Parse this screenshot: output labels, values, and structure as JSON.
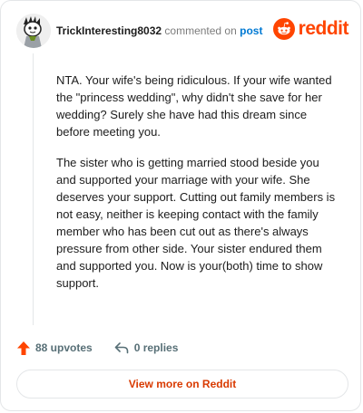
{
  "comment": {
    "username": "TrickInteresting8032",
    "commented_text": "commented on",
    "post_link": "post",
    "brand_name": "reddit",
    "paragraphs": [
      "NTA. Your wife's being ridiculous. If your wife wanted the \"princess wedding\", why didn't she save for her wedding? Surely she have had this dream since before meeting you.",
      "The sister who is getting married stood beside you and supported your marriage with your wife. She deserves your support. Cutting out family members is not easy, neither is keeping contact with the family member who has been cut out as there's always pressure from other side. Your sister endured them and supported you. Now is your(both) time to show support."
    ]
  },
  "actions": {
    "upvotes_label": "88 upvotes",
    "replies_label": "0 replies"
  },
  "view_button_label": "View more on Reddit",
  "colors": {
    "brand": "#ff4500",
    "link": "#0079d3",
    "button_text": "#d93a00"
  },
  "icons": {
    "upvote": "upvote-arrow-icon",
    "reply": "reply-arrow-icon",
    "brand": "reddit-snoo-icon"
  }
}
